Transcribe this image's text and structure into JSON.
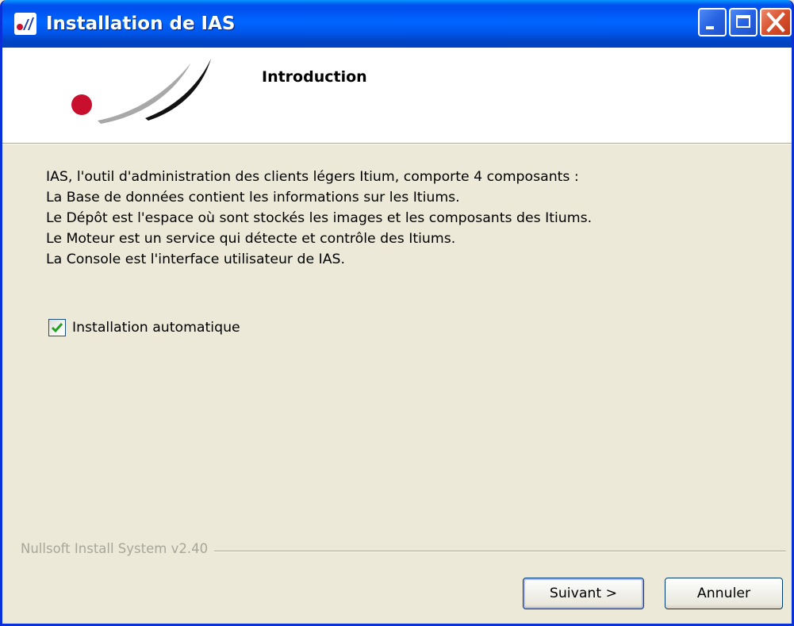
{
  "window": {
    "title": "Installation de IAS",
    "title_icon": "ias-logo-icon",
    "controls": [
      "minimize-icon",
      "maximize-icon",
      "close-icon"
    ]
  },
  "header": {
    "title": "Introduction",
    "logo": "ias-swoosh-logo"
  },
  "body": {
    "lines": [
      "IAS, l'outil d'administration des clients légers Itium, comporte 4 composants :",
      "La Base de données contient les informations sur les Itiums.",
      "Le Dépôt est l'espace où sont stockés les images et les composants des Itiums.",
      "Le Moteur est un service qui détecte et contrôle des Itiums.",
      "La Console est l'interface utilisateur de IAS."
    ],
    "checkbox": {
      "label": "Installation automatique",
      "checked": true
    }
  },
  "footer": {
    "branding": "Nullsoft Install System v2.40",
    "next_label": "Suivant >",
    "cancel_label": "Annuler"
  },
  "colors": {
    "titlebar": "#0055ea",
    "dialog_bg": "#ece9d8",
    "header_bg": "#ffffff",
    "logo_red": "#c8102e",
    "checkmark_green": "#21a121"
  }
}
